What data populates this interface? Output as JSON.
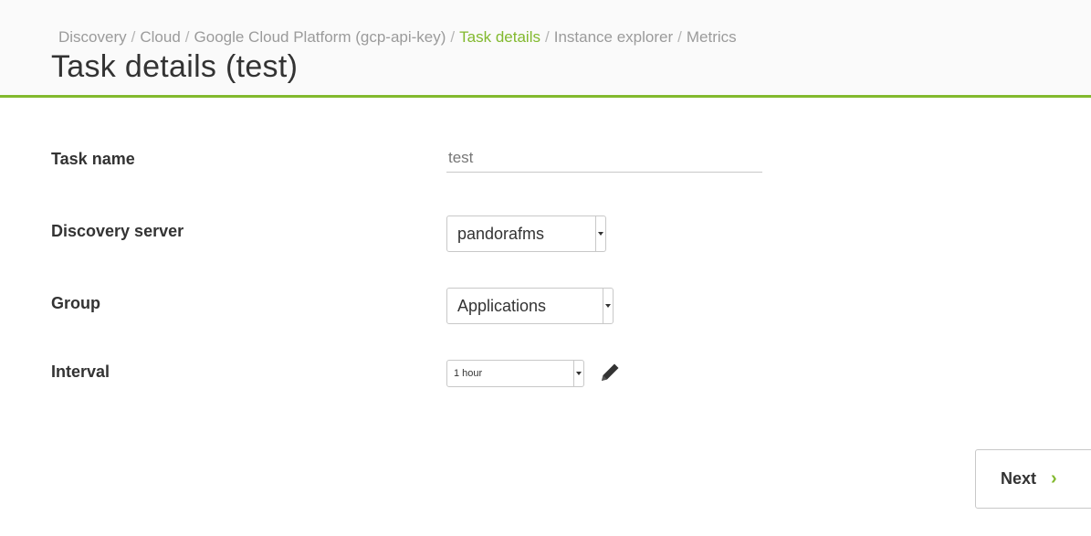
{
  "breadcrumb": {
    "items": [
      {
        "label": "Discovery",
        "active": false
      },
      {
        "label": "Cloud",
        "active": false
      },
      {
        "label": "Google Cloud Platform (gcp-api-key)",
        "active": false
      },
      {
        "label": "Task details",
        "active": true
      },
      {
        "label": "Instance explorer",
        "active": false
      },
      {
        "label": "Metrics",
        "active": false
      }
    ],
    "separator": "/"
  },
  "page": {
    "title": "Task details (test)"
  },
  "form": {
    "task_name": {
      "label": "Task name",
      "value": "test"
    },
    "discovery_server": {
      "label": "Discovery server",
      "selected": "pandorafms"
    },
    "group": {
      "label": "Group",
      "selected": "Applications"
    },
    "interval": {
      "label": "Interval",
      "selected": "1 hour",
      "edit_icon": "pencil-icon"
    }
  },
  "actions": {
    "next_label": "Next",
    "next_icon": "chevron-right-icon"
  },
  "colors": {
    "accent": "#82b92e",
    "breadcrumb_text": "#9b9b9b",
    "title_text": "#333333"
  }
}
